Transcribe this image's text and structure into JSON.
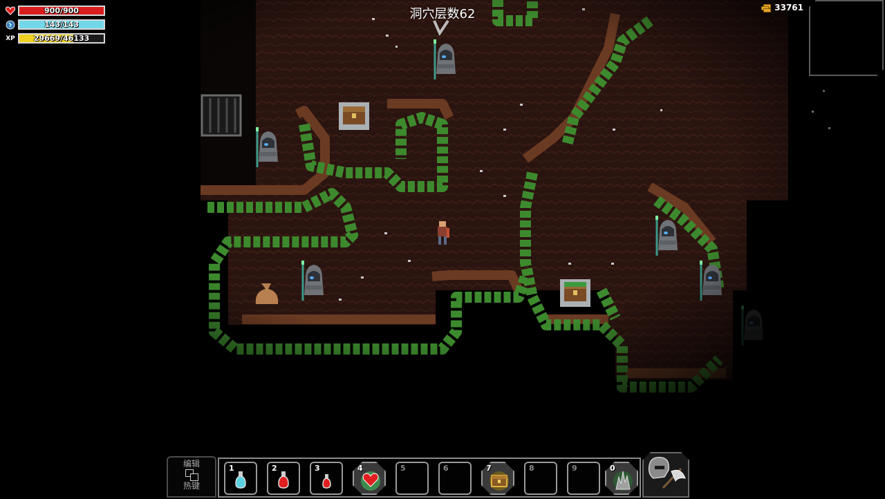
{
  "hud": {
    "hp": {
      "text": "900/900",
      "fraction": 1.0,
      "color": "#d91c1c",
      "icon": "heart-icon"
    },
    "mp": {
      "text": "143/143",
      "fraction": 1.0,
      "color": "#72d6e8",
      "icon": "mana-orb-icon"
    },
    "xp": {
      "label": "XP",
      "text": "29669/46133",
      "fraction": 0.643,
      "color": "#f0d020",
      "icon": "xp-icon"
    }
  },
  "header": {
    "floor_title": "洞穴层数62"
  },
  "gold": {
    "amount": "33761",
    "icon": "gold-coins-icon"
  },
  "hotbar": {
    "edit_line1": "编辑",
    "edit_line2": "热键",
    "slots": [
      {
        "num": "1",
        "item": "blue-potion-icon"
      },
      {
        "num": "2",
        "item": "red-potion-icon"
      },
      {
        "num": "3",
        "item": "red-potion-icon"
      },
      {
        "num": "4",
        "item": "heart-ability-icon"
      },
      {
        "num": "5",
        "item": ""
      },
      {
        "num": "6",
        "item": ""
      },
      {
        "num": "7",
        "item": "treasure-chest-ability-icon"
      },
      {
        "num": "8",
        "item": ""
      },
      {
        "num": "9",
        "item": ""
      },
      {
        "num": "0",
        "item": "spike-ability-icon"
      }
    ],
    "weapon": "axe-helmet-icon"
  },
  "colors": {
    "cave_floor": "#2a1510",
    "dirt_edge": "#5a3020",
    "moss": "#3d8a2e",
    "background": "#000000"
  }
}
